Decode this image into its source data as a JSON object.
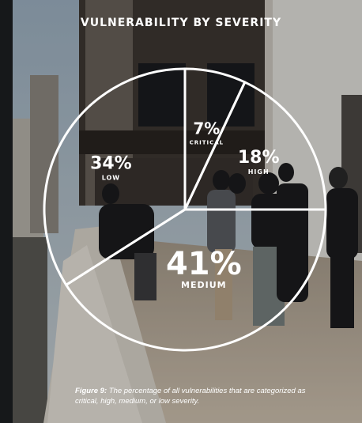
{
  "chart_data": {
    "type": "pie",
    "title": "VULNERABILITY BY SEVERITY",
    "slices": [
      {
        "label": "CRITICAL",
        "value": 7,
        "display": "7%"
      },
      {
        "label": "HIGH",
        "value": 18,
        "display": "18%"
      },
      {
        "label": "MEDIUM",
        "value": 41,
        "display": "41%"
      },
      {
        "label": "LOW",
        "value": 34,
        "display": "34%"
      }
    ],
    "start_angle_deg": 0,
    "direction": "clockwise",
    "colors": {
      "outline": "#ffffff",
      "fill": "transparent"
    }
  },
  "caption": {
    "figure_label": "Figure 9:",
    "text": "The percentage of all vulnerabilities that are categorized as critical, high, medium, or low severity."
  }
}
